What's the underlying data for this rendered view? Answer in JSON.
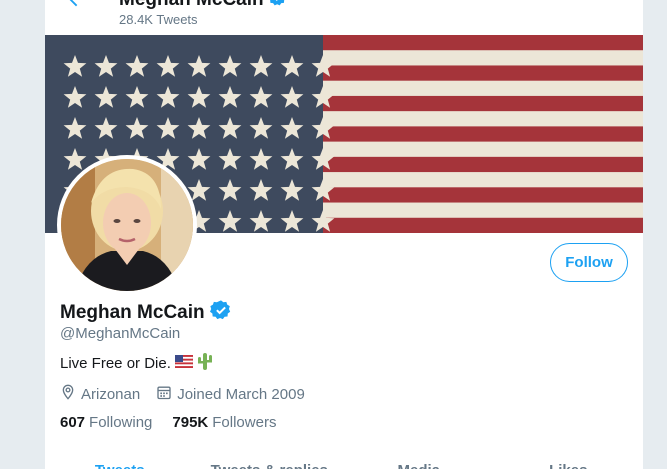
{
  "header": {
    "name": "Meghan McCain",
    "tweet_count": "28.4K Tweets"
  },
  "profile": {
    "display_name": "Meghan McCain",
    "handle": "@MeghanMcCain",
    "bio_text": "Live Free or Die.",
    "bio_emojis": [
      "us-flag-emoji",
      "cactus-emoji"
    ],
    "location": "Arizonan",
    "joined": "Joined March 2009",
    "following_count": "607",
    "following_label": "Following",
    "followers_count": "795K",
    "followers_label": "Followers",
    "verified": true
  },
  "actions": {
    "follow_label": "Follow"
  },
  "tabs": [
    {
      "label": "Tweets",
      "active": true
    },
    {
      "label": "Tweets & replies",
      "active": false
    },
    {
      "label": "Media",
      "active": false
    },
    {
      "label": "Likes",
      "active": false
    }
  ],
  "colors": {
    "accent": "#1da1f2",
    "secondary_text": "#657786",
    "flag_blue": "#3e4a5e",
    "flag_red": "#a5343a",
    "flag_white": "#ece6d7"
  },
  "icons": {
    "back": "arrow-left-icon",
    "verified": "verified-badge-icon",
    "location": "location-pin-icon",
    "calendar": "calendar-icon"
  }
}
